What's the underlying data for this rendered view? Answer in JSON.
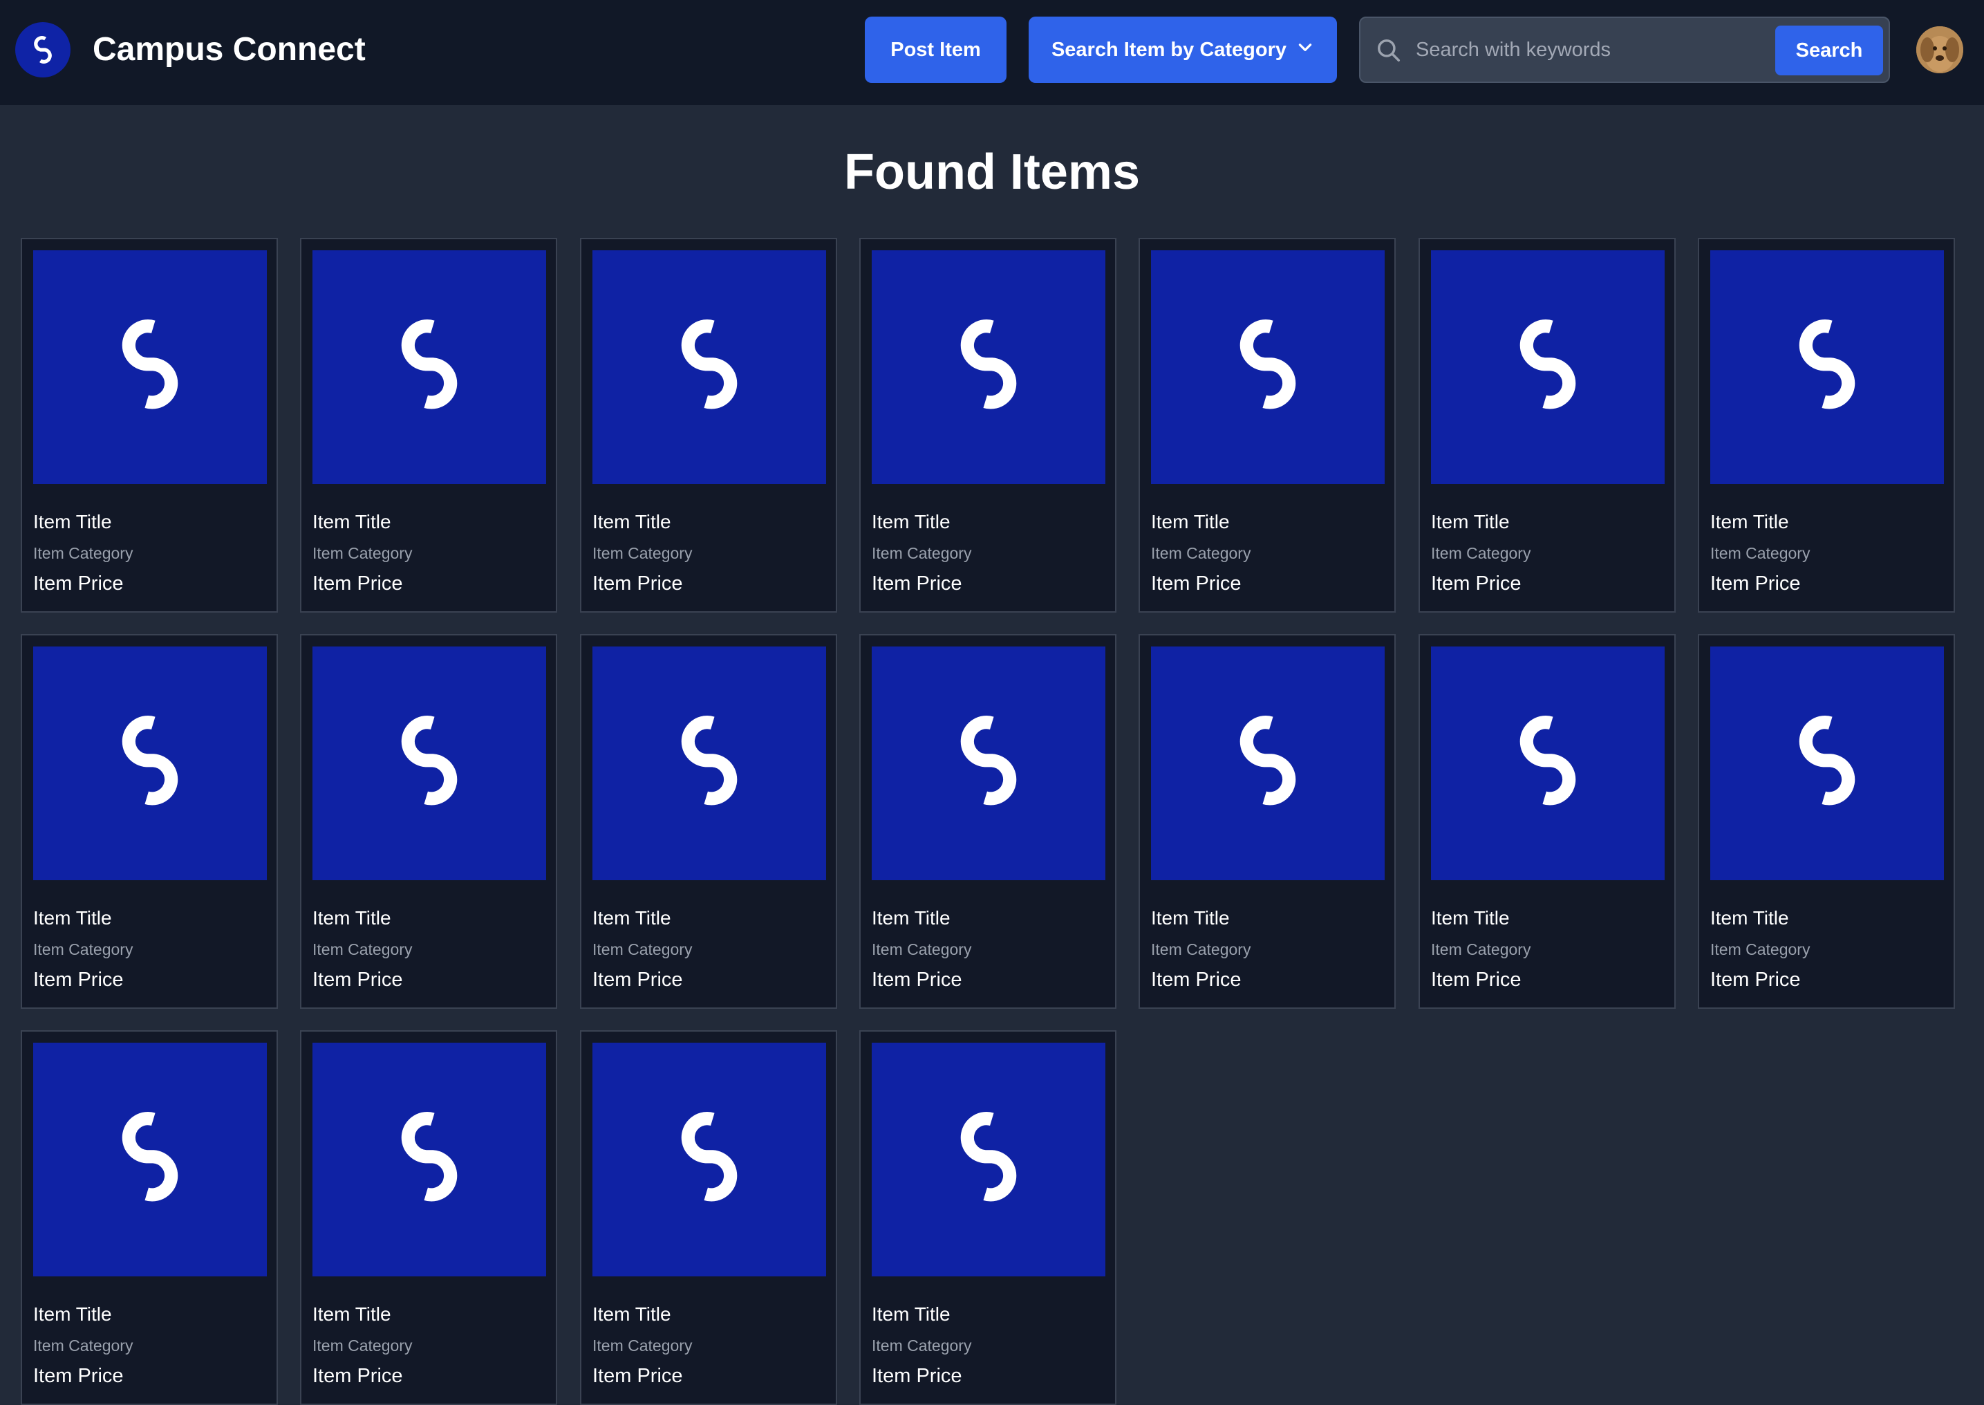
{
  "app": {
    "name": "Campus Connect",
    "logo_icon": "campus-connect-s-logo",
    "colors": {
      "header_bg": "#111827",
      "page_bg": "#222a39",
      "accent": "#2f63ea",
      "logo_blue": "#0f22a4"
    }
  },
  "header": {
    "post_item_label": "Post Item",
    "category_label": "Search Item by Category",
    "category_icon": "chevron-down-icon",
    "search": {
      "placeholder": "Search with keywords",
      "value": "",
      "button_label": "Search",
      "icon": "search-icon"
    },
    "avatar_icon": "user-avatar-dog"
  },
  "main": {
    "title": "Found Items",
    "items": [
      {
        "title": "Item Title",
        "category": "Item Category",
        "price": "Item Price"
      },
      {
        "title": "Item Title",
        "category": "Item Category",
        "price": "Item Price"
      },
      {
        "title": "Item Title",
        "category": "Item Category",
        "price": "Item Price"
      },
      {
        "title": "Item Title",
        "category": "Item Category",
        "price": "Item Price"
      },
      {
        "title": "Item Title",
        "category": "Item Category",
        "price": "Item Price"
      },
      {
        "title": "Item Title",
        "category": "Item Category",
        "price": "Item Price"
      },
      {
        "title": "Item Title",
        "category": "Item Category",
        "price": "Item Price"
      },
      {
        "title": "Item Title",
        "category": "Item Category",
        "price": "Item Price"
      },
      {
        "title": "Item Title",
        "category": "Item Category",
        "price": "Item Price"
      },
      {
        "title": "Item Title",
        "category": "Item Category",
        "price": "Item Price"
      },
      {
        "title": "Item Title",
        "category": "Item Category",
        "price": "Item Price"
      },
      {
        "title": "Item Title",
        "category": "Item Category",
        "price": "Item Price"
      },
      {
        "title": "Item Title",
        "category": "Item Category",
        "price": "Item Price"
      },
      {
        "title": "Item Title",
        "category": "Item Category",
        "price": "Item Price"
      },
      {
        "title": "Item Title",
        "category": "Item Category",
        "price": "Item Price"
      },
      {
        "title": "Item Title",
        "category": "Item Category",
        "price": "Item Price"
      },
      {
        "title": "Item Title",
        "category": "Item Category",
        "price": "Item Price"
      },
      {
        "title": "Item Title",
        "category": "Item Category",
        "price": "Item Price"
      }
    ]
  }
}
